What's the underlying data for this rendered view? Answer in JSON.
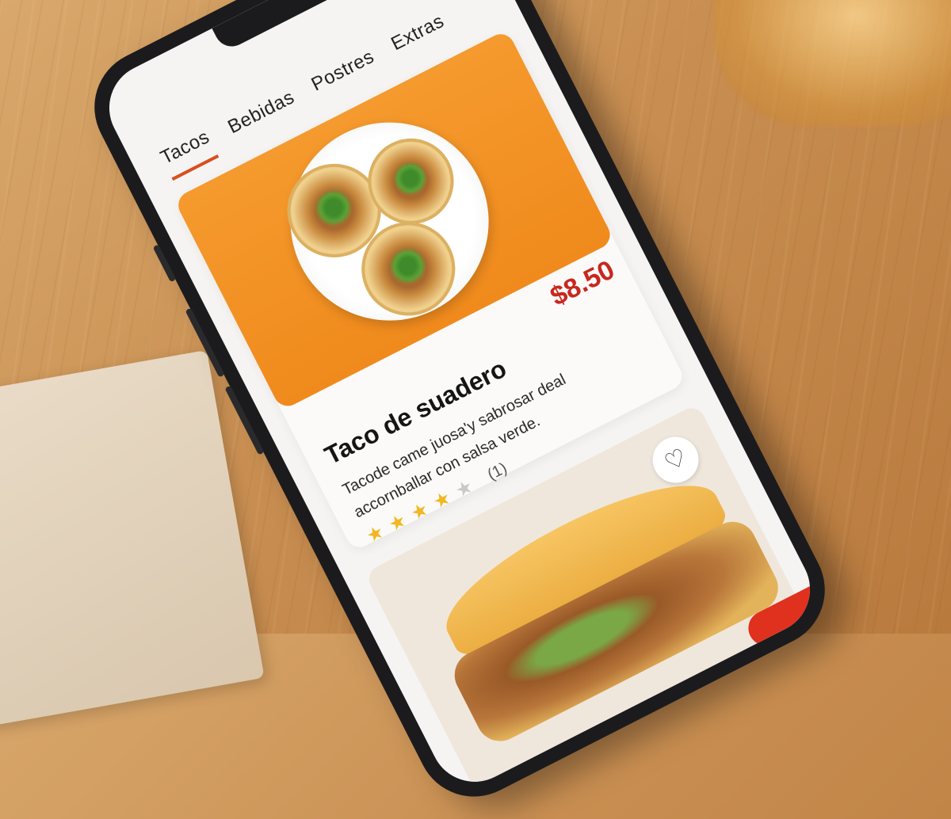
{
  "tabs": [
    {
      "label": "Tacos",
      "active": true
    },
    {
      "label": "Bebidas",
      "active": false
    },
    {
      "label": "Postres",
      "active": false
    },
    {
      "label": "Extras",
      "active": false
    }
  ],
  "featured_item": {
    "title": "Taco de suadero",
    "price": "$8.50",
    "description": "Tacode came juosa'y sabrosar deal accornballar con salsa verde.",
    "rating": {
      "stars_filled": 4,
      "stars_total": 5,
      "review_count": "(1)"
    }
  },
  "second_item": {
    "favorite_icon": "heart-outline-icon"
  },
  "colors": {
    "accent": "#d94e1f",
    "price": "#c8281f",
    "hero_bg": "#f59a2e",
    "star": "#f2b722"
  }
}
